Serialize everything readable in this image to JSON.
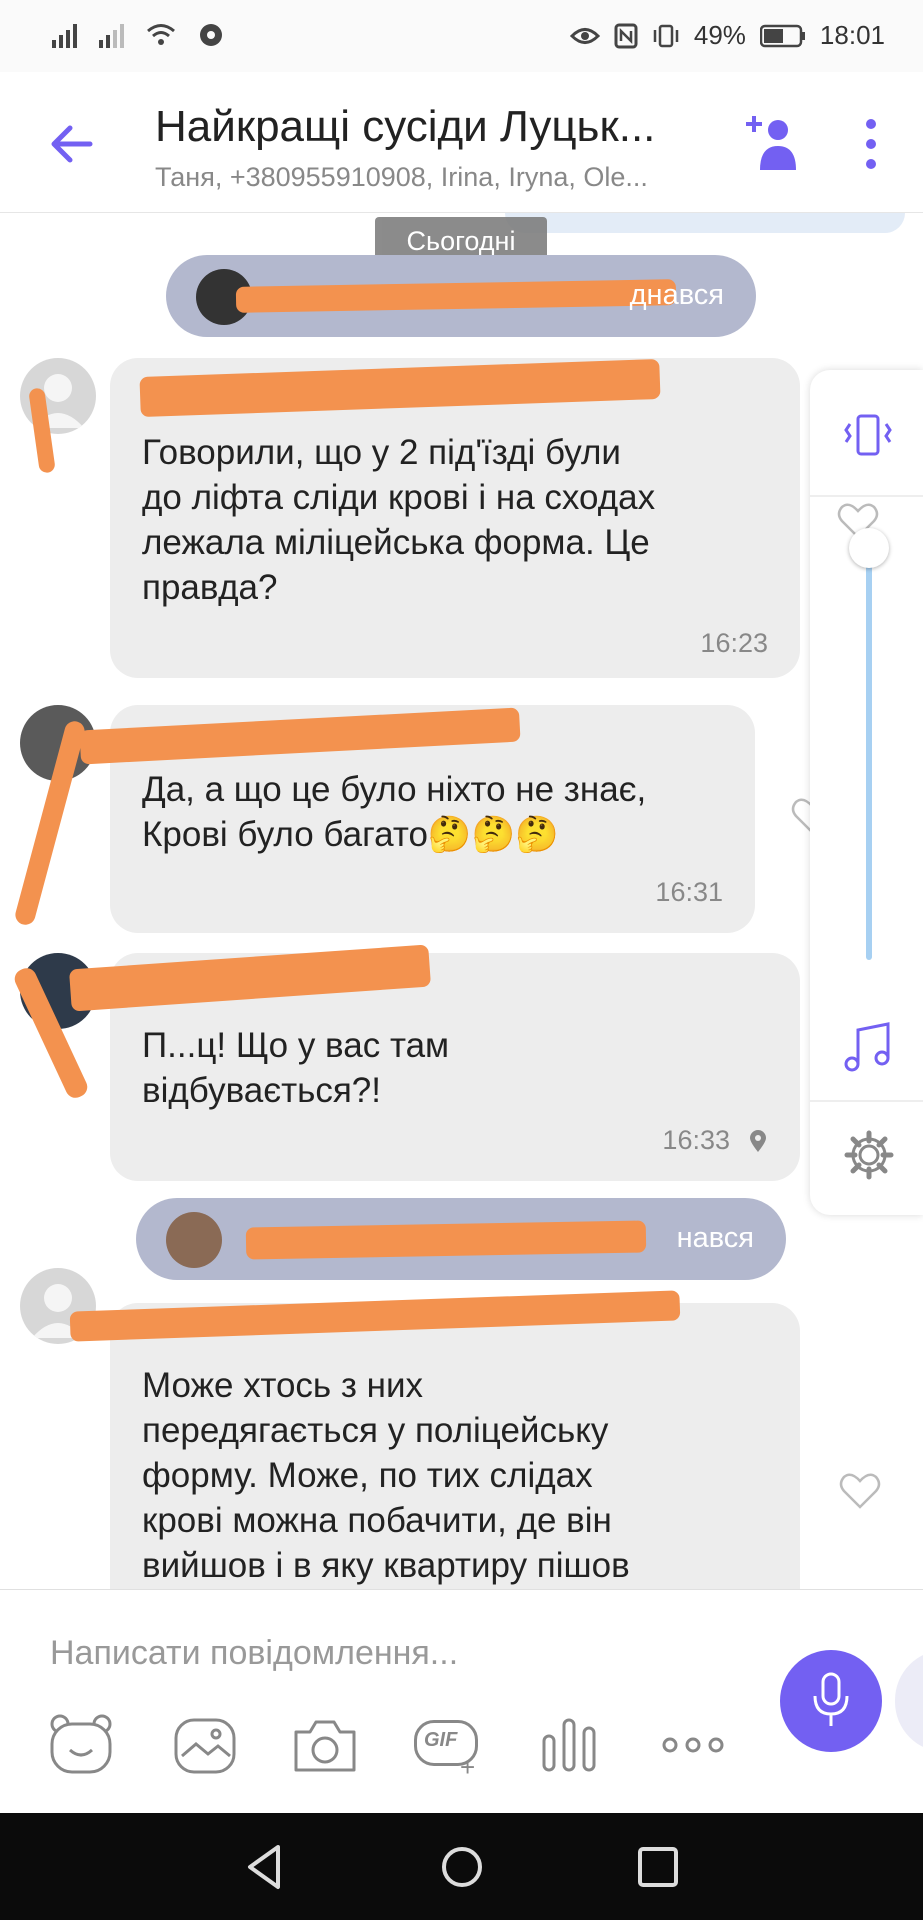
{
  "status_bar": {
    "battery": "49%",
    "time": "18:01"
  },
  "header": {
    "title": "Найкращі сусіди Луцьк...",
    "subtitle": "Таня, +380955910908, Irina, Iryna, Ole..."
  },
  "chat": {
    "date_label": "Сьогодні",
    "system_1": "днався",
    "system_2": "нався",
    "messages": [
      {
        "text": "Говорили, що у 2 під'їзді були\nдо ліфта сліди крові і на сходах\nлежала міліцейська форма. Це\nправда?",
        "time": "16:23"
      },
      {
        "text": "Да, а що це було ніхто не знає,\nКрові було багато🤔🤔🤔",
        "time": "16:31"
      },
      {
        "text": "П...ц! Що у вас там\nвідбувається?!",
        "time": "16:33"
      },
      {
        "text": "Може хтось з них\nпередягається у поліцейську\nформу. Може, по тих слідах\nкрові можна побачити, де він\nвийшов і в яку квартиру пішов"
      }
    ]
  },
  "input": {
    "placeholder": "Написати повідомлення...",
    "gif_label": "GIF"
  },
  "colors": {
    "accent": "#7360f2",
    "bubble": "#ededed",
    "redaction": "#f3924f",
    "system_pill": "#b3b8ce"
  }
}
